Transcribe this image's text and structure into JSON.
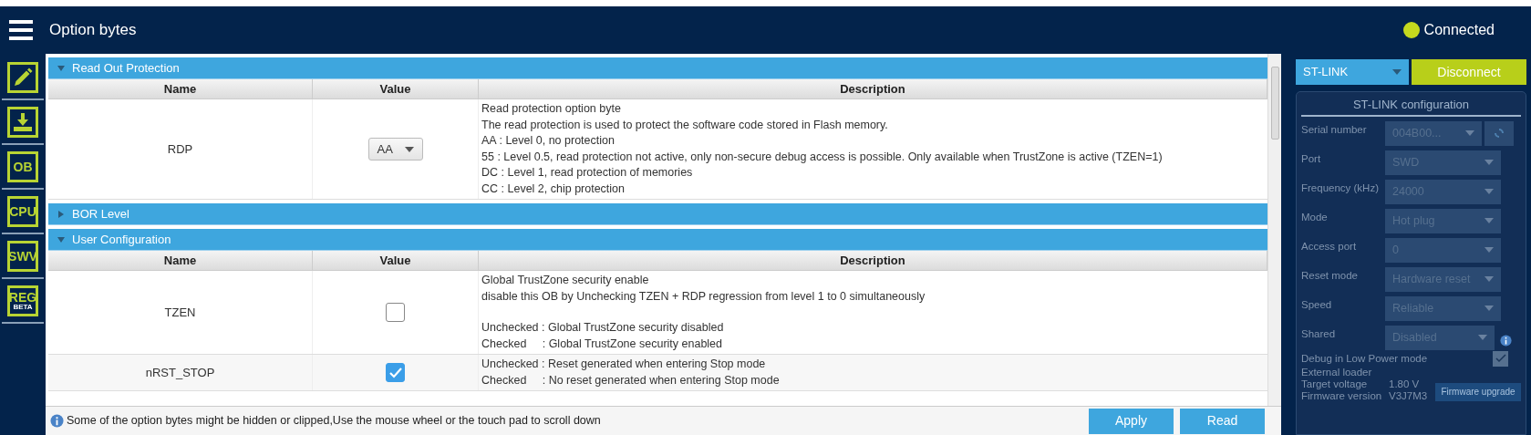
{
  "header": {
    "title": "Option bytes",
    "status": "Connected"
  },
  "sidebar": [
    {
      "kind": "pencil"
    },
    {
      "kind": "download"
    },
    {
      "kind": "label",
      "label": "OB"
    },
    {
      "kind": "label",
      "label": "CPU"
    },
    {
      "kind": "label",
      "label": "SWV"
    },
    {
      "kind": "label",
      "label": "REG",
      "sublabel": "BETA"
    }
  ],
  "sections": [
    {
      "title": "Read Out Protection",
      "expanded": true,
      "columns": [
        "Name",
        "Value",
        "Description"
      ],
      "rows": [
        {
          "name": "RDP",
          "kind": "select",
          "value": "AA",
          "description": [
            [
              "Read protection option byte",
              "The read protection is used to protect the software code stored in Flash memory.",
              "AA : Level 0, no protection",
              "55 : Level 0.5, read protection not active, only non-secure debug access is possible. Only available when TrustZone is active (TZEN=1)",
              "DC : Level 1, read protection of memories",
              "CC : Level 2, chip protection"
            ]
          ]
        }
      ]
    },
    {
      "title": "BOR Level",
      "expanded": false
    },
    {
      "title": "User Configuration",
      "expanded": true,
      "columns": [
        "Name",
        "Value",
        "Description"
      ],
      "rows": [
        {
          "name": "TZEN",
          "kind": "checkbox",
          "checked": false,
          "description": [
            [
              "Global TrustZone security enable",
              "disable this OB by Unchecking TZEN + RDP regression from level 1 to 0 simultaneously"
            ],
            [
              "Unchecked : Global TrustZone security disabled",
              "Checked     : Global TrustZone security enabled"
            ]
          ]
        },
        {
          "name": "nRST_STOP",
          "kind": "checkbox",
          "checked": true,
          "description": [
            [
              "Unchecked : Reset generated when entering Stop mode",
              "Checked     : No reset generated when entering Stop mode"
            ]
          ]
        }
      ]
    }
  ],
  "footer": {
    "note": "Some of the option bytes might be hidden or clipped,Use the mouse wheel or the touch pad to scroll down",
    "buttons": [
      "Apply",
      "Read"
    ]
  },
  "connection": {
    "probe": "ST-LINK",
    "button": "Disconnect",
    "config": {
      "title": "ST-LINK configuration",
      "fields": [
        {
          "label": "Serial number",
          "value": "004B00...",
          "kind": "refresh",
          "disabled": true
        },
        {
          "label": "Port",
          "value": "SWD",
          "kind": "select",
          "disabled": true
        },
        {
          "label": "Frequency (kHz)",
          "value": "24000",
          "kind": "select",
          "disabled": true
        },
        {
          "label": "Mode",
          "value": "Hot plug",
          "kind": "select",
          "disabled": true
        },
        {
          "label": "Access port",
          "value": "0",
          "kind": "select",
          "disabled": true
        },
        {
          "label": "Reset mode",
          "value": "Hardware reset",
          "kind": "select",
          "disabled": true
        },
        {
          "label": "Speed",
          "value": "Reliable",
          "kind": "select",
          "disabled": true
        },
        {
          "label": "Shared",
          "value": "Disabled",
          "kind": "info",
          "disabled": true
        }
      ],
      "low_power": {
        "label": "Debug in Low Power mode",
        "checked": true,
        "disabled": true
      },
      "info": [
        {
          "label": "External loader"
        },
        {
          "label": "Target voltage",
          "value": "1.80 V"
        },
        {
          "label": "Firmware version",
          "value": "V3J7M3"
        }
      ],
      "firmware_button": {
        "label": "Firmware upgrade",
        "disabled": true
      }
    }
  }
}
